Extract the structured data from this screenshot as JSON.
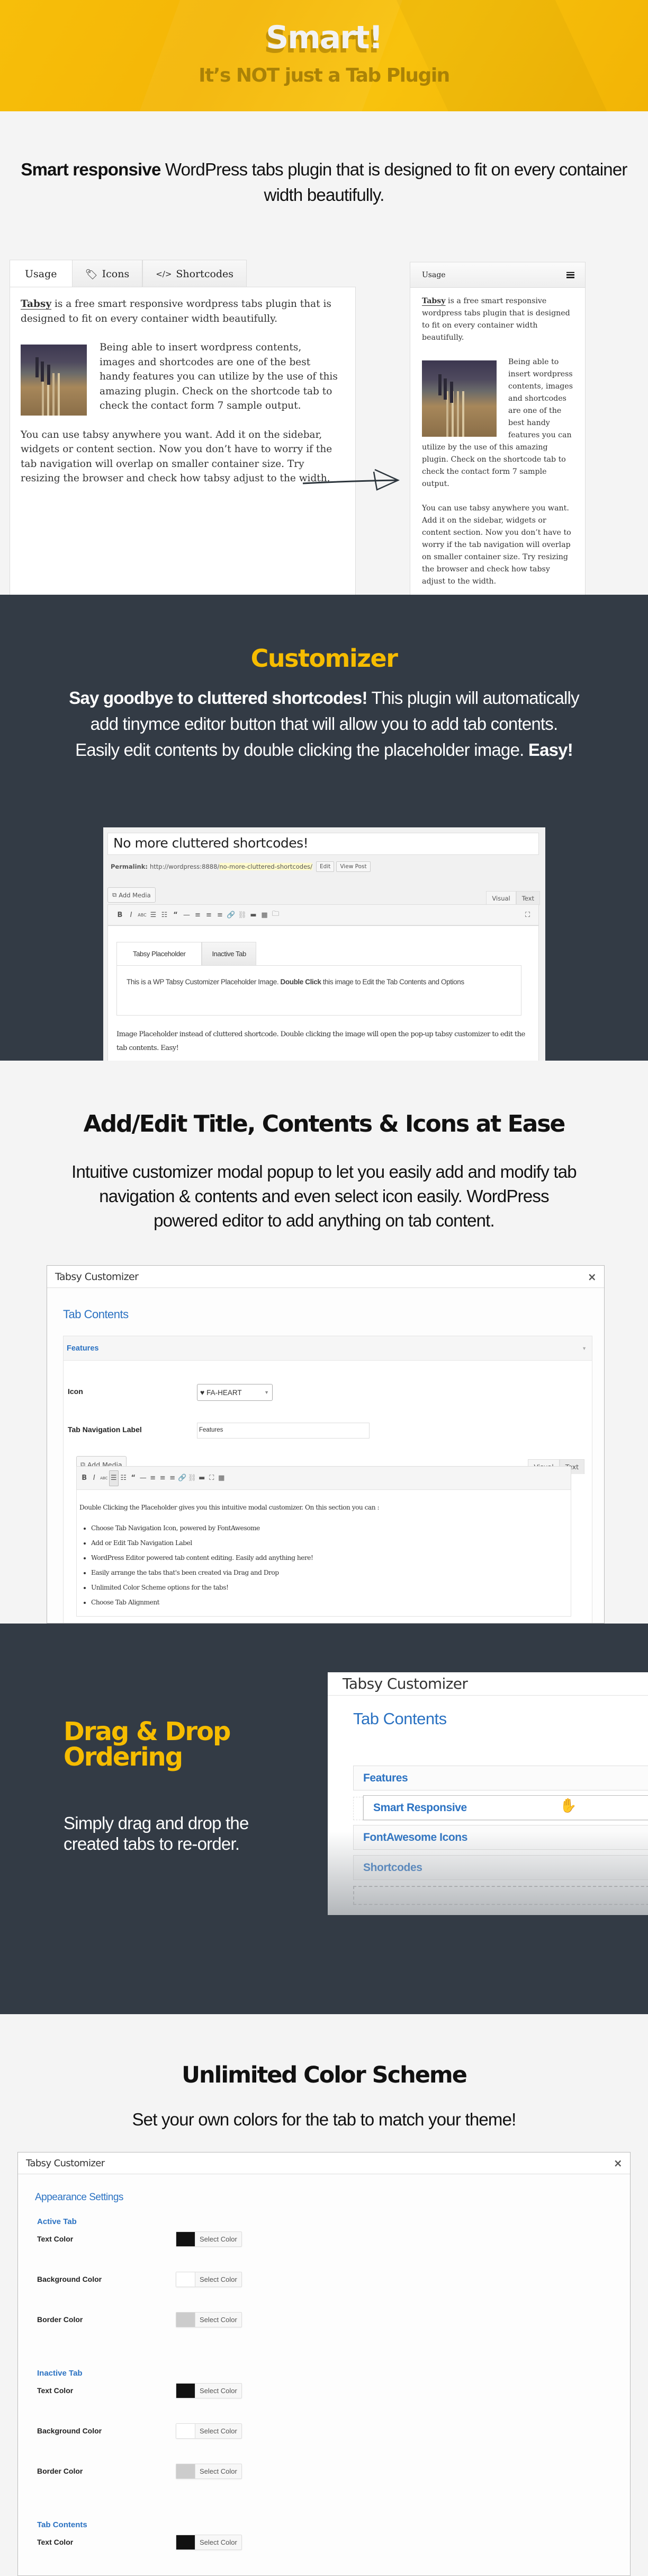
{
  "hero": {
    "title": "Smart!",
    "subtitle": "It’s NOT just a Tab Plugin",
    "bg_color": "#f5b805"
  },
  "intro": {
    "bold": "Smart responsive",
    "text": " WordPress tabs plugin that is designed to fit on every container width beautifully."
  },
  "wide_demo": {
    "tabs": [
      {
        "label": "Usage",
        "icon": null,
        "active": true
      },
      {
        "label": "Icons",
        "icon": "tags-icon",
        "active": false
      },
      {
        "label": "Shortcodes",
        "icon": "code-icon",
        "active": false
      }
    ],
    "p1_link": "Tabsy",
    "p1_text": " is a free smart responsive wordpress tabs plugin that is designed to fit on every container width beautifully.",
    "p2": "Being able to insert wordpress contents, images and shortcodes are one of the best handy features you can utilize by the use of this amazing plugin. Check on the shortcode tab to check the contact form 7 sample output.",
    "p3": "You can use tabsy anywhere you want. Add it on the sidebar, widgets or content section. Now you don’t have to worry if the tab navigation will overlap on smaller container size. Try resizing the browser and check how tabsy adjust to the width."
  },
  "narrow_demo": {
    "active_tab": "Usage",
    "menu_icon": "hamburger-icon"
  },
  "customizer": {
    "title": "Customizer",
    "text_bold1": "Say goodbye to cluttered shortcodes!",
    "text": " This plugin will automatically add tinymce editor button that will allow you to add tab contents. Easily edit contents by double clicking the placeholder image. ",
    "text_bold2": "Easy!",
    "accent": "#f6bc00",
    "dark_bg": "#333b45",
    "editor": {
      "post_title": "No more cluttered shortcodes!",
      "permalink_label": "Permalink:",
      "permalink_base": "http://wordpress:8888/",
      "permalink_slug": "no-more-cluttered-shortcodes/",
      "edit_btn": "Edit",
      "view_btn": "View Post",
      "add_media": "Add Media",
      "visual": "Visual",
      "text": "Text",
      "placeholder_tabs": [
        "Tabsy Placeholder",
        "Inactive Tab"
      ],
      "placeholder_text_a": "This is a WP Tabsy Customizer Placeholder Image. ",
      "placeholder_text_bold": "Double Click",
      "placeholder_text_b": " this image to Edit the Tab Contents and Options",
      "caption": "Image Placeholder instead of cluttered shortcode. Double clicking the image will open the pop-up tabsy customizer to edit the tab contents. Easy!"
    }
  },
  "add_edit": {
    "title": "Add/Edit Title, Contents & Icons at Ease",
    "text": "Intuitive customizer modal popup to let you easily add and modify tab navigation & contents and even select icon easily. WordPress powered editor to add anything on tab content.",
    "modal": {
      "title": "Tabsy Customizer",
      "close": "×",
      "section": "Tab Contents",
      "accordion_title": "Features",
      "icon_label": "Icon",
      "icon_value": "FA-HEART",
      "nav_label": "Tab Navigation Label",
      "nav_value": "Features",
      "add_media": "Add Media",
      "visual": "Visual",
      "text": "Text",
      "body_intro": "Double Clicking the Placeholder gives you this intuitive modal customizer. On this section you can :",
      "bullets": [
        "Choose Tab Navigation Icon, powered by FontAwesome",
        "Add or Edit Tab Navigation Label",
        "WordPress Editor powered tab content editing. Easily add anything here!",
        "Easily arrange the tabs that's been created via Drag and Drop",
        "Unlimited Color Scheme options for the tabs!",
        "Choose Tab Alignment"
      ]
    }
  },
  "drag_drop": {
    "title_line1": "Drag & Drop",
    "title_line2": "Ordering",
    "text": "Simply drag and drop the created tabs to re-order.",
    "modal": {
      "title": "Tabsy Customizer",
      "section": "Tab Contents",
      "items": [
        "Features",
        "Smart Responsive",
        "FontAwesome Icons",
        "Shortcodes"
      ],
      "dragging_index": 1
    }
  },
  "color_scheme": {
    "title": "Unlimited Color Scheme",
    "text": "Set your own colors for the tab to match your theme!",
    "modal": {
      "title": "Tabsy Customizer",
      "close": "×",
      "section": "Appearance Settings",
      "select_label": "Select Color",
      "groups": [
        {
          "name": "Active Tab",
          "rows": [
            {
              "label": "Text Color",
              "color": "#111111"
            },
            {
              "label": "Background Color",
              "color": "#ffffff"
            },
            {
              "label": "Border Color",
              "color": "#cccccc"
            }
          ]
        },
        {
          "name": "Inactive Tab",
          "rows": [
            {
              "label": "Text Color",
              "color": "#111111"
            },
            {
              "label": "Background Color",
              "color": "#ffffff"
            },
            {
              "label": "Border Color",
              "color": "#cccccc"
            }
          ]
        },
        {
          "name": "Tab Contents",
          "rows": [
            {
              "label": "Text Color",
              "color": "#111111"
            }
          ]
        }
      ]
    }
  }
}
